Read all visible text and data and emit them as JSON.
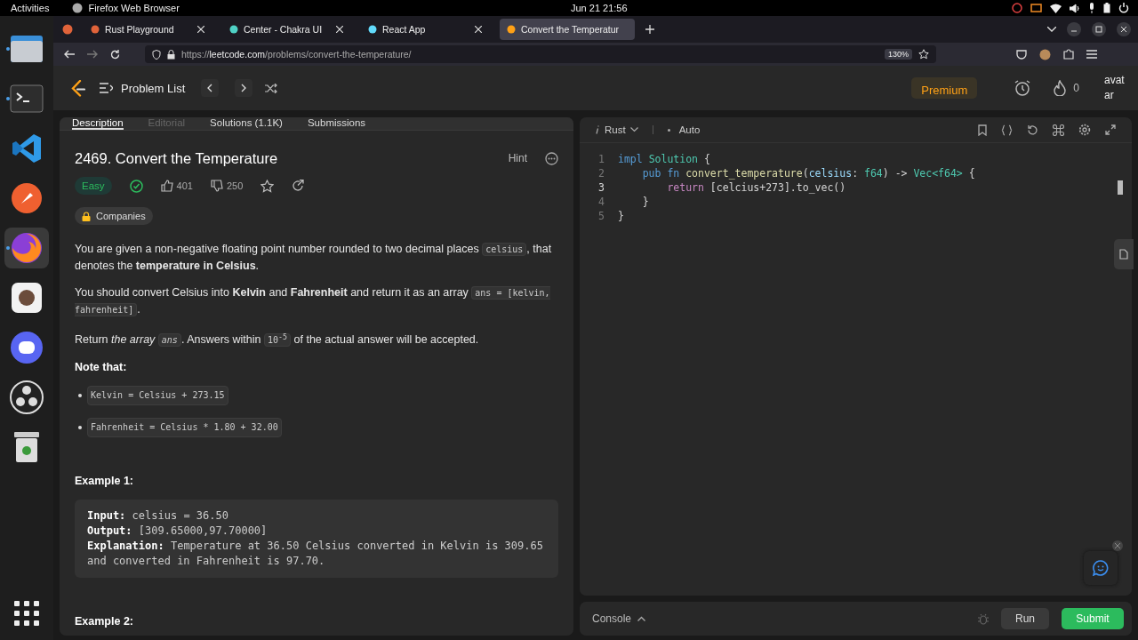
{
  "top_bar": {
    "activities": "Activities",
    "app_name": "Firefox Web Browser",
    "clock": "Jun 21  21:56"
  },
  "dock": [
    {
      "running": true,
      "selected": false
    },
    {
      "running": true,
      "selected": false
    },
    {
      "running": false,
      "selected": false
    },
    {
      "running": false,
      "selected": false
    },
    {
      "running": true,
      "selected": true
    },
    {
      "running": false,
      "selected": false
    },
    {
      "running": false,
      "selected": false
    },
    {
      "running": false,
      "selected": false
    },
    {
      "running": false,
      "selected": false
    }
  ],
  "browser_tabs": [
    {
      "title": "Rust Playground",
      "selected": false
    },
    {
      "title": "Center - Chakra UI",
      "selected": false
    },
    {
      "title": "React App",
      "selected": false
    },
    {
      "title": "Convert the Temperatur",
      "selected": true
    }
  ],
  "address_bar": {
    "url_prefix": "https://",
    "url_host": "leetcode.com",
    "url_path": "/problems/convert-the-temperature/",
    "zoom": "130%"
  },
  "header": {
    "problem_list": "Problem List",
    "premium": "Premium",
    "streak": "0",
    "avatar": "avatar"
  },
  "panel_tabs": [
    {
      "label": "Description",
      "selected": true,
      "disabled": false
    },
    {
      "label": "Editorial",
      "selected": false,
      "disabled": true
    },
    {
      "label": "Solutions (1.1K)",
      "selected": false,
      "disabled": false
    },
    {
      "label": "Submissions",
      "selected": false,
      "disabled": false
    }
  ],
  "problem": {
    "title": "2469. Convert the Temperature",
    "hint": "Hint",
    "difficulty": "Easy",
    "solved": true,
    "likes": "401",
    "dislikes": "250",
    "companies": "Companies",
    "paragraphs": [
      [
        {
          "kind": "text",
          "text": "You are given a non-negative floating point number rounded to two decimal places "
        },
        {
          "kind": "code",
          "text": "celsius"
        },
        {
          "kind": "text",
          "text": ", that denotes the **temperature in Celsius**."
        }
      ],
      [
        {
          "kind": "text",
          "text": "You should convert Celsius into **Kelvin** and **Fahrenheit** and return it as an array "
        },
        {
          "kind": "code",
          "text": "ans = [kelvin, fahrenheit]"
        },
        {
          "kind": "text",
          "text": "."
        }
      ],
      [
        {
          "kind": "text",
          "text": "Return *the array* "
        },
        {
          "kind": "code",
          "text": "*ans*"
        },
        {
          "kind": "text",
          "text": ". Answers within "
        },
        {
          "kind": "code",
          "text": "10$^{-5}$"
        },
        {
          "kind": "text",
          "text": " of the actual answer will be accepted."
        }
      ]
    ],
    "note_heading": "Note that:",
    "notes": [
      "Kelvin = Celsius + 273.15",
      "Fahrenheit = Celsius * 1.80 + 32.00"
    ],
    "examples": [
      {
        "heading": "Example 1:",
        "lines": [
          {
            "label": "Input:",
            "value": "celsius = 36.50"
          },
          {
            "label": "Output:",
            "value": "[309.65000,97.70000]"
          },
          {
            "label": "Explanation:",
            "value": "Temperature at 36.50 Celsius converted in Kelvin is 309.65 and converted in Fahrenheit is 97.70."
          }
        ]
      },
      {
        "heading": "Example 2:"
      }
    ]
  },
  "editor": {
    "language": "Rust",
    "mode": "Auto",
    "lines": [
      {
        "number": "1",
        "selected": false,
        "tokens": [
          {
            "kind": "keyword",
            "text": "impl "
          },
          {
            "kind": "type",
            "text": "Solution"
          },
          {
            "kind": "plain",
            "text": " {"
          }
        ]
      },
      {
        "number": "2",
        "selected": false,
        "tokens": [
          {
            "kind": "keyword",
            "text": "    pub fn "
          },
          {
            "kind": "function",
            "text": "convert_temperature"
          },
          {
            "kind": "plain",
            "text": "("
          },
          {
            "kind": "param",
            "text": "celsius"
          },
          {
            "kind": "plain",
            "text": ": "
          },
          {
            "kind": "type",
            "text": "f64"
          },
          {
            "kind": "plain",
            "text": ") -> "
          },
          {
            "kind": "type",
            "text": "Vec<f64>"
          },
          {
            "kind": "plain",
            "text": " {"
          }
        ]
      },
      {
        "number": "3",
        "selected": true,
        "tokens": [
          {
            "kind": "control",
            "text": "        return"
          },
          {
            "kind": "plain",
            "text": " [celcius+273].to_vec()"
          }
        ]
      },
      {
        "number": "4",
        "selected": false,
        "tokens": [
          {
            "kind": "plain",
            "text": "    }"
          }
        ]
      },
      {
        "number": "5",
        "selected": false,
        "tokens": [
          {
            "kind": "plain",
            "text": "}"
          }
        ]
      }
    ]
  },
  "console": {
    "label": "Console",
    "run": "Run",
    "submit": "Submit"
  }
}
